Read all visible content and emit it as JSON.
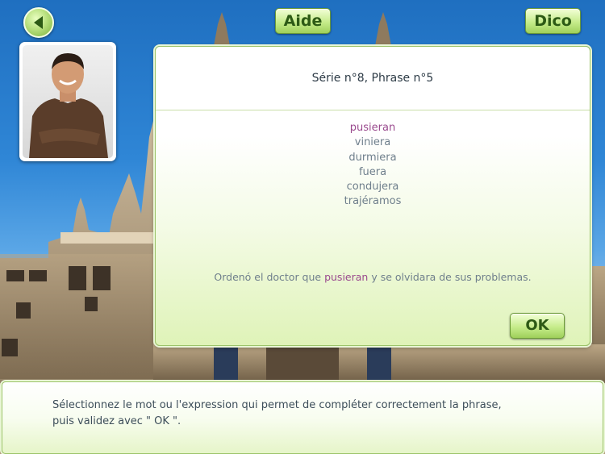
{
  "toolbar": {
    "help_label": "Aide",
    "dictionary_label": "Dico"
  },
  "panel": {
    "title": "Série n°8, Phrase n°5",
    "choices": [
      "pusieran",
      "viniera",
      "durmiera",
      "fuera",
      "condujera",
      "trajéramos"
    ],
    "selected_index": 0,
    "sentence_before": "Ordenó el doctor que ",
    "sentence_answer": "pusieran",
    "sentence_after": " y se olvidara de sus problemas.",
    "ok_label": "OK"
  },
  "footer": {
    "instruction_line1": "Sélectionnez le mot ou l'expression qui permet de compléter correctement la phrase,",
    "instruction_line2": "puis validez avec \" OK \"."
  },
  "colors": {
    "accent_green": "#9fd05a",
    "selected_text": "#9a4a8e",
    "text_grey": "#6f7f8c"
  }
}
